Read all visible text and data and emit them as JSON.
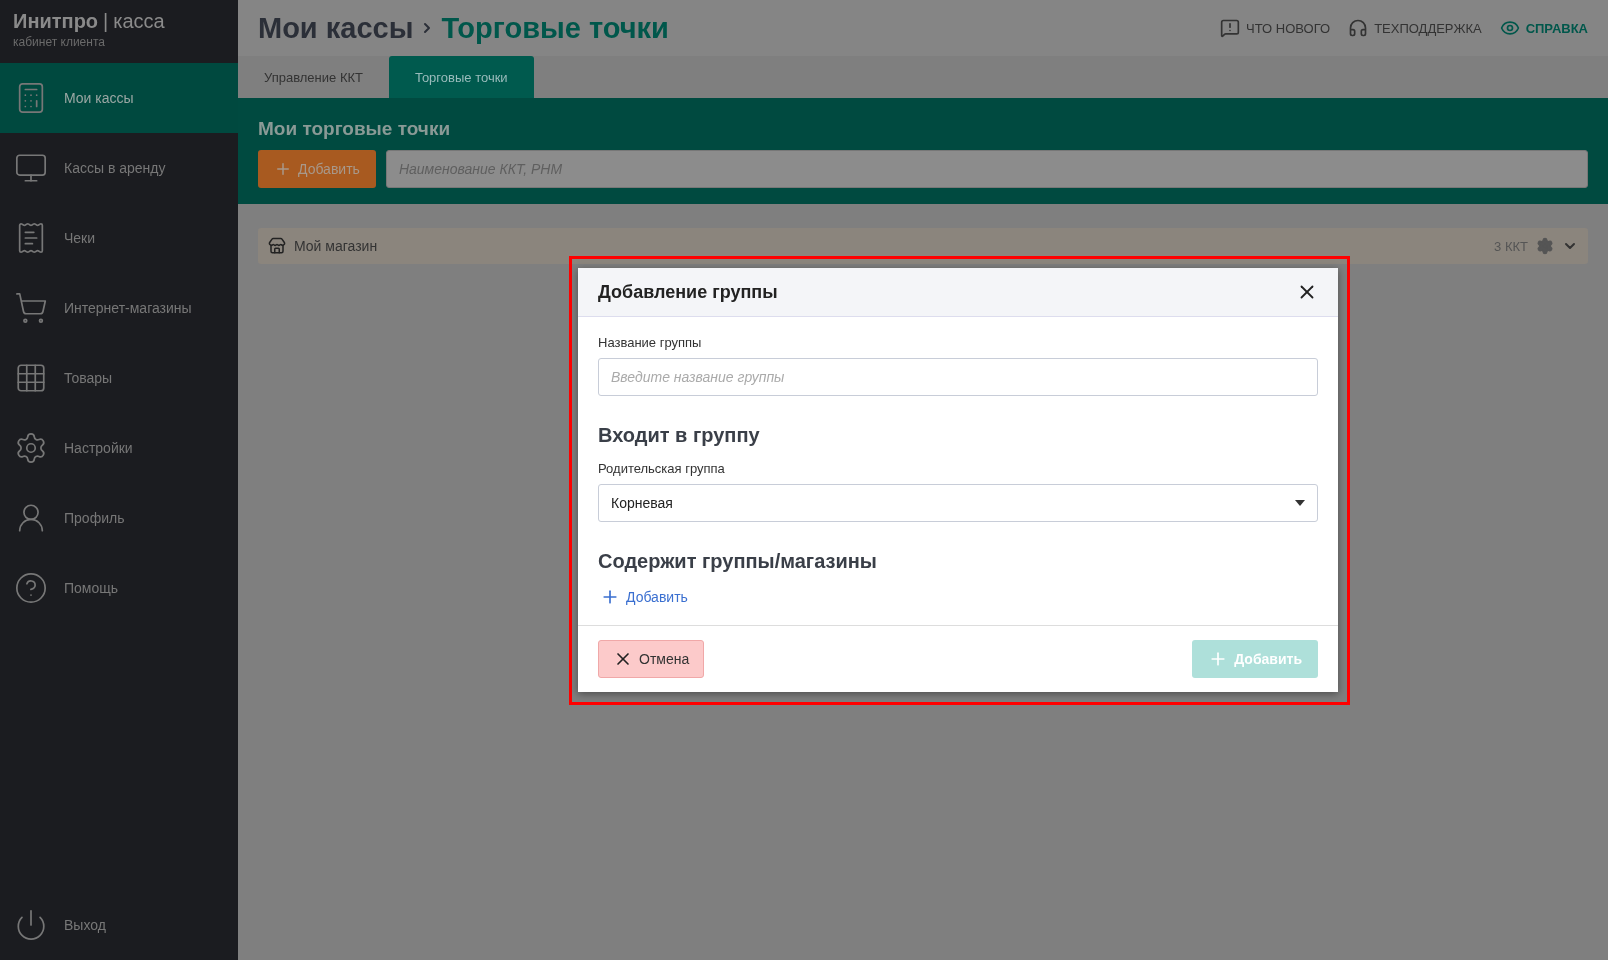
{
  "sidebar": {
    "brand_bold": "Инитпро",
    "brand_separator": "|",
    "brand_light": "касса",
    "subtitle": "кабинет клиента",
    "items": [
      {
        "label": "Мои кассы",
        "selected": true
      },
      {
        "label": "Кассы в аренду",
        "selected": false
      },
      {
        "label": "Чеки",
        "selected": false
      },
      {
        "label": "Интернет-магазины",
        "selected": false
      },
      {
        "label": "Товары",
        "selected": false
      },
      {
        "label": "Настройки",
        "selected": false
      },
      {
        "label": "Профиль",
        "selected": false
      },
      {
        "label": "Помощь",
        "selected": false
      }
    ],
    "logout": {
      "label": "Выход"
    }
  },
  "header": {
    "breadcrumb": [
      "Мои кассы",
      "Торговые точки"
    ],
    "links": [
      {
        "label": "ЧТО НОВОГО",
        "accent": false
      },
      {
        "label": "ТЕХПОДДЕРЖКА",
        "accent": false
      },
      {
        "label": "СПРАВКА",
        "accent": true
      }
    ]
  },
  "tabs": [
    {
      "label": "Управление ККТ",
      "selected": false
    },
    {
      "label": "Торговые точки",
      "selected": true
    }
  ],
  "toolbar": {
    "title": "Мои торговые точки",
    "add_button": "Добавить",
    "search": {
      "placeholder": "Наименование ККТ, РНМ"
    }
  },
  "stores": [
    {
      "name": "Мой магазин",
      "count": "3 ККТ"
    }
  ],
  "dialog": {
    "title": "Добавление группы",
    "name_label": "Название группы",
    "name_field": {
      "placeholder": "Введите название группы"
    },
    "parent_heading": "Входит в группу",
    "parent_label": "Родительская группа",
    "parent_select": {
      "value": "Корневая"
    },
    "children_heading": "Содержит группы/магазины",
    "children_add": "Добавить",
    "cancel_button": "Отмена",
    "submit_button": {
      "label": "Добавить",
      "disabled": true
    }
  }
}
